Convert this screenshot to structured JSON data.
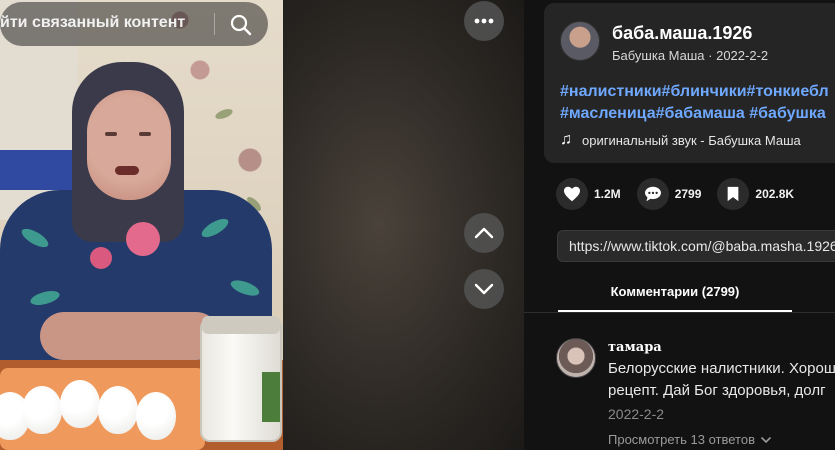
{
  "video": {
    "search_placeholder": "йти связанный контент"
  },
  "controls": {
    "more_icon": "more-horizontal-icon",
    "prev_icon": "chevron-up-icon",
    "next_icon": "chevron-down-icon"
  },
  "author": {
    "username": "баба.маша.1926",
    "display_name": "Бабушка Маша",
    "separator": " · ",
    "date": "2022-2-2",
    "hashtags_line1": "#налистники#блинчики#тонкиебл",
    "hashtags_line2": "#масленица#бабамаша #бабушка",
    "sound": "оригинальный звук - Бабушка Маша"
  },
  "stats": {
    "likes": "1.2M",
    "comments": "2799",
    "saves": "202.8K"
  },
  "share": {
    "url": "https://www.tiktok.com/@baba.masha.1926"
  },
  "tabs": {
    "comments_label": "Комментарии (2799)"
  },
  "comment": {
    "name": "тамара",
    "line1": "Белорусские налистники. Хорош",
    "line2": "рецепт. Дай Бог здоровья, долг",
    "date": "2022-2-2",
    "view_replies": "Просмотреть 13 ответов"
  },
  "colors": {
    "accent_link": "#6fa8ff",
    "panel_bg": "#121212",
    "card_bg": "#252525"
  }
}
